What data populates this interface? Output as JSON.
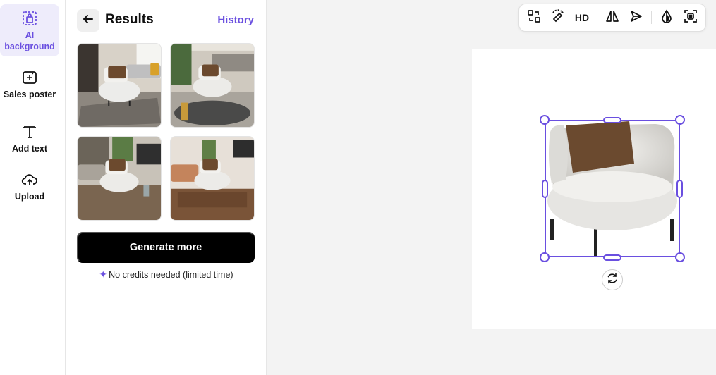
{
  "sidebar": {
    "items": [
      {
        "label": "AI background",
        "icon": "ai-background-icon",
        "active": true
      },
      {
        "label": "Sales poster",
        "icon": "sales-poster-icon"
      },
      {
        "label": "Add text",
        "icon": "text-icon"
      },
      {
        "label": "Upload",
        "icon": "upload-icon"
      }
    ]
  },
  "panel": {
    "title": "Results",
    "history_label": "History",
    "results": [
      {
        "alt": "living room with grey rug"
      },
      {
        "alt": "living room with glass table"
      },
      {
        "alt": "living room with wood floor"
      },
      {
        "alt": "living room with wooden table"
      }
    ],
    "generate_label": "Generate more",
    "credits_note": "No credits needed (limited time)"
  },
  "toolbar": {
    "hd_label": "HD",
    "tools": [
      "swap-icon",
      "eraser-icon",
      "hd",
      "flip-icon",
      "send-icon",
      "opacity-icon",
      "focus-icon"
    ]
  },
  "colors": {
    "accent": "#6a4fe0",
    "active_bg": "#eeecfb"
  }
}
